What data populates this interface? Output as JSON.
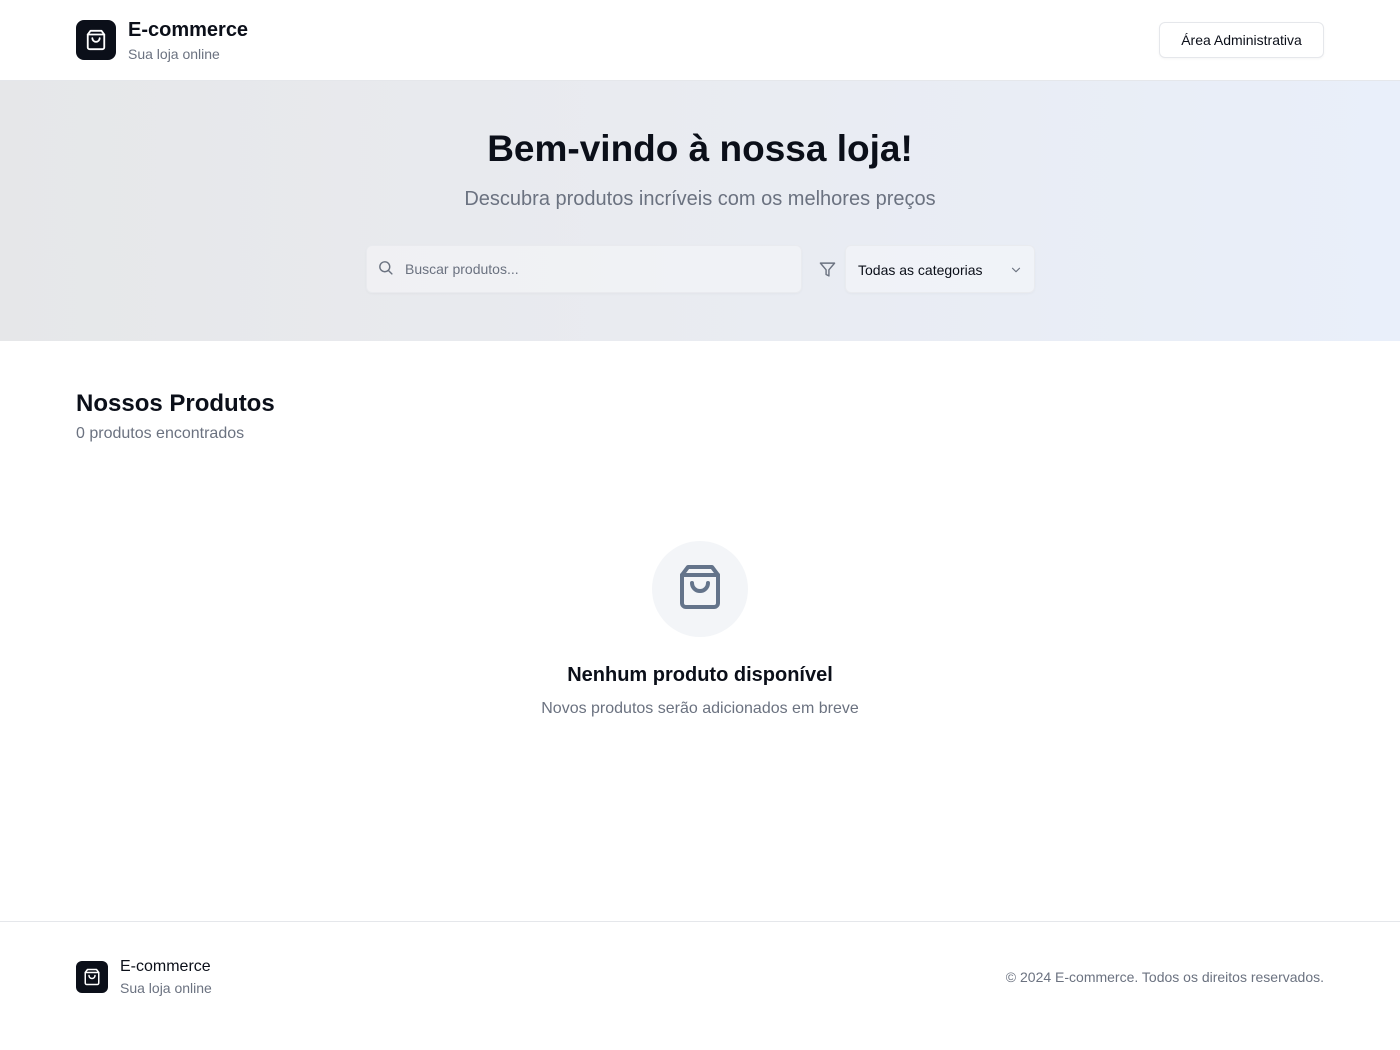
{
  "header": {
    "brand_title": "E-commerce",
    "brand_subtitle": "Sua loja online",
    "logo_icon": "shopping-bag-icon",
    "admin_button_label": "Área Administrativa"
  },
  "hero": {
    "title": "Bem-vindo à nossa loja!",
    "subtitle": "Descubra produtos incríveis com os melhores preços",
    "search": {
      "placeholder": "Buscar produtos...",
      "value": "",
      "icon": "search-icon"
    },
    "filter_icon": "filter-icon",
    "category_select": {
      "selected": "Todas as categorias",
      "icon": "chevron-down-icon"
    }
  },
  "products": {
    "title": "Nossos Produtos",
    "count_text": "0 produtos encontrados",
    "empty_state": {
      "icon": "shopping-bag-icon",
      "title": "Nenhum produto disponível",
      "subtitle": "Novos produtos serão adicionados em breve"
    }
  },
  "footer": {
    "brand_title": "E-commerce",
    "brand_subtitle": "Sua loja online",
    "copyright": "© 2024 E-commerce. Todos os direitos reservados."
  },
  "colors": {
    "primary": "#0b0f19",
    "muted_text": "#6b7280",
    "border": "#e5e7eb",
    "hero_gradient_start": "#e6e7e9",
    "hero_gradient_end": "#e9effa"
  }
}
